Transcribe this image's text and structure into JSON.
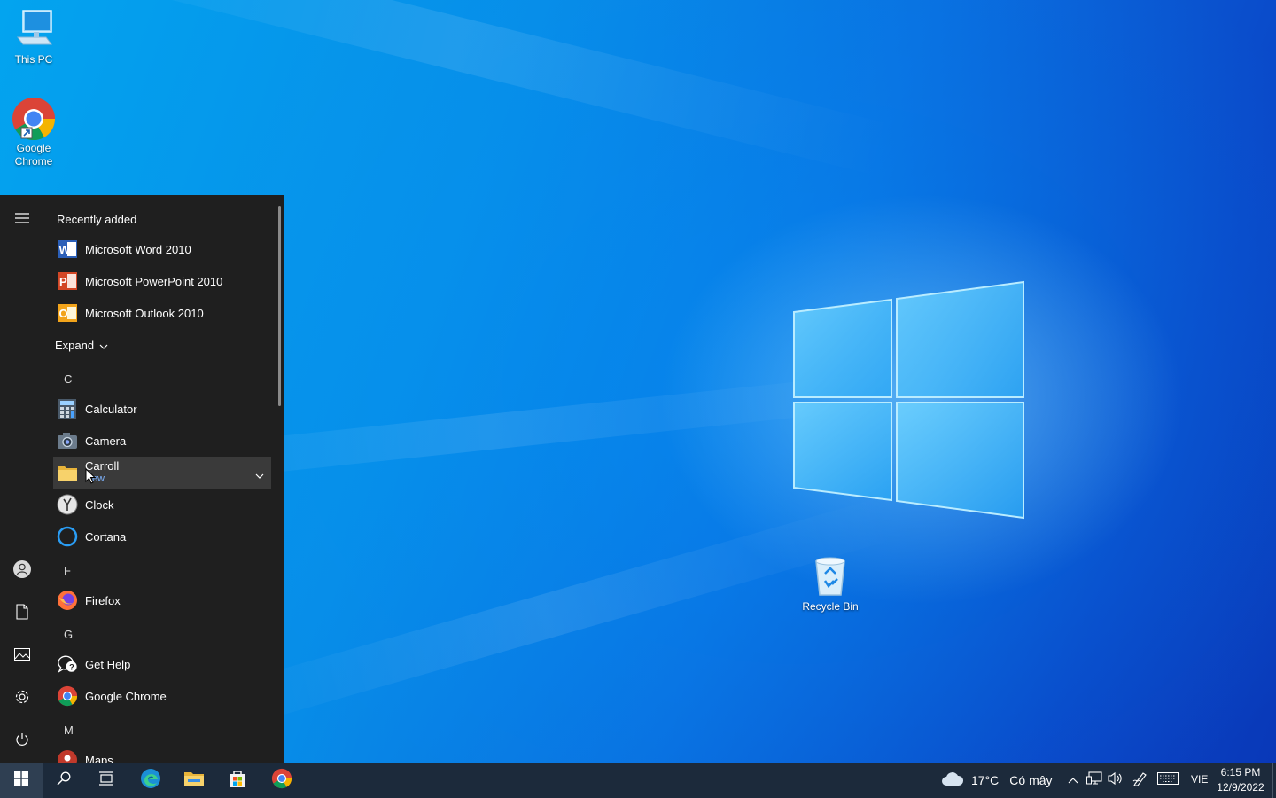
{
  "desktop": {
    "icons": {
      "this_pc": "This PC",
      "google_chrome": "Google\nChrome",
      "recycle_bin": "Recycle Bin"
    }
  },
  "start_menu": {
    "recently_added_label": "Recently added",
    "recent": [
      {
        "label": "Microsoft Word 2010",
        "icon": "word-icon"
      },
      {
        "label": "Microsoft PowerPoint 2010",
        "icon": "powerpoint-icon"
      },
      {
        "label": "Microsoft Outlook 2010",
        "icon": "outlook-icon"
      }
    ],
    "expand_label": "Expand",
    "letters": {
      "c": "C",
      "f": "F",
      "g": "G",
      "m": "M"
    },
    "apps": {
      "calculator": "Calculator",
      "camera": "Camera",
      "carroll": "Carroll",
      "carroll_sub": "New",
      "clock": "Clock",
      "cortana": "Cortana",
      "firefox": "Firefox",
      "get_help": "Get Help",
      "google_chrome": "Google Chrome",
      "maps": "Maps"
    }
  },
  "taskbar": {
    "weather": {
      "temp": "17°C",
      "condition": "Có mây"
    },
    "language": "VIE",
    "time": "6:15 PM",
    "date": "12/9/2022"
  },
  "colors": {
    "start_menu_bg": "#1f1f1f",
    "taskbar_bg": "#1c2a3b",
    "hover_bg": "#3a3a3a",
    "accent_blue": "#0a6fe0"
  }
}
